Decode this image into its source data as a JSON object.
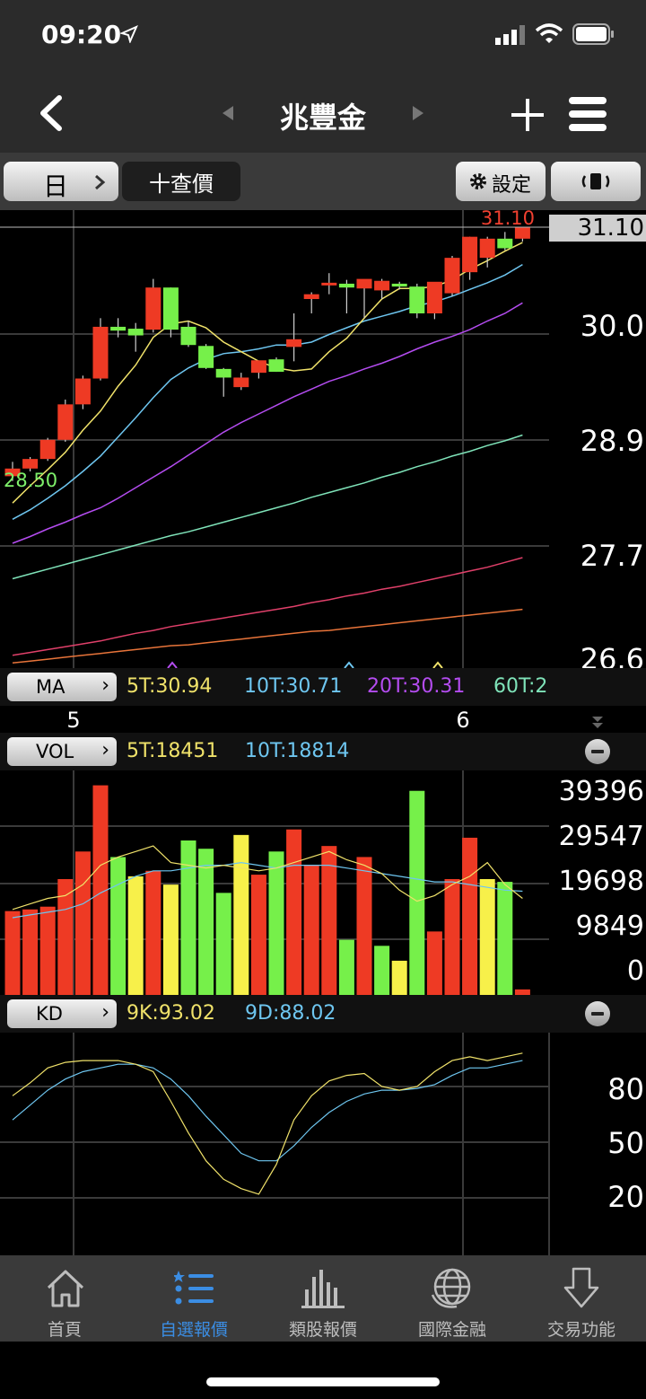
{
  "status": {
    "time": "09:20"
  },
  "nav": {
    "title": "兆豐金"
  },
  "toolbar": {
    "period_label": "日",
    "quote_label": "十查價",
    "settings_label": "設定"
  },
  "price_axis": {
    "current": "31.10",
    "labels": [
      "30.0",
      "28.9",
      "27.7",
      "26.6"
    ]
  },
  "ma": {
    "label": "MA",
    "high_marker": "31.10",
    "low_marker": "28.50",
    "ma5": "5T:30.94",
    "ma10": "10T:30.71",
    "ma20": "20T:30.31",
    "ma60": "60T:2",
    "colors": {
      "ma5": "#f0e26a",
      "ma10": "#6ec6f0",
      "ma20": "#b44cf0",
      "ma60": "#7fe3b9"
    }
  },
  "months": [
    "5",
    "6"
  ],
  "vol": {
    "label": "VOL",
    "v5": "5T:18451",
    "v10": "10T:18814",
    "axis": [
      "39396",
      "29547",
      "19698",
      "9849",
      "0"
    ]
  },
  "kd": {
    "label": "KD",
    "k": "9K:93.02",
    "d": "9D:88.02",
    "axis": [
      "80",
      "50",
      "20"
    ]
  },
  "tabs": [
    {
      "label": "首頁",
      "icon": "home-icon"
    },
    {
      "label": "自選報價",
      "icon": "list-icon"
    },
    {
      "label": "類股報價",
      "icon": "bar-chart-icon"
    },
    {
      "label": "國際金融",
      "icon": "globe-icon"
    },
    {
      "label": "交易功能",
      "icon": "download-icon"
    }
  ],
  "chart_data": {
    "type": "candlestick",
    "price_range": [
      26.6,
      31.1
    ],
    "candles": [
      {
        "o": 28.5,
        "h": 28.65,
        "l": 28.45,
        "c": 28.58
      },
      {
        "o": 28.58,
        "h": 28.7,
        "l": 28.55,
        "c": 28.68
      },
      {
        "o": 28.68,
        "h": 28.9,
        "l": 28.66,
        "c": 28.88
      },
      {
        "o": 28.88,
        "h": 29.3,
        "l": 28.86,
        "c": 29.25
      },
      {
        "o": 29.25,
        "h": 29.55,
        "l": 29.2,
        "c": 29.52
      },
      {
        "o": 29.52,
        "h": 30.15,
        "l": 29.5,
        "c": 30.06
      },
      {
        "o": 30.06,
        "h": 30.15,
        "l": 29.95,
        "c": 30.02
      },
      {
        "o": 30.04,
        "h": 30.1,
        "l": 29.8,
        "c": 29.97
      },
      {
        "o": 30.03,
        "h": 30.56,
        "l": 30.0,
        "c": 30.47
      },
      {
        "o": 30.47,
        "h": 30.47,
        "l": 29.95,
        "c": 30.03
      },
      {
        "o": 30.06,
        "h": 30.12,
        "l": 29.85,
        "c": 29.87
      },
      {
        "o": 29.86,
        "h": 29.88,
        "l": 29.62,
        "c": 29.63
      },
      {
        "o": 29.62,
        "h": 29.63,
        "l": 29.33,
        "c": 29.53
      },
      {
        "o": 29.43,
        "h": 29.58,
        "l": 29.4,
        "c": 29.53
      },
      {
        "o": 29.58,
        "h": 29.7,
        "l": 29.52,
        "c": 29.71
      },
      {
        "o": 29.72,
        "h": 29.74,
        "l": 29.59,
        "c": 29.59
      },
      {
        "o": 29.85,
        "h": 30.2,
        "l": 29.7,
        "c": 29.93
      },
      {
        "o": 30.35,
        "h": 30.42,
        "l": 30.2,
        "c": 30.4
      },
      {
        "o": 30.5,
        "h": 30.62,
        "l": 30.4,
        "c": 30.52
      },
      {
        "o": 30.51,
        "h": 30.55,
        "l": 30.2,
        "c": 30.47
      },
      {
        "o": 30.46,
        "h": 30.52,
        "l": 30.15,
        "c": 30.56
      },
      {
        "o": 30.44,
        "h": 30.56,
        "l": 30.35,
        "c": 30.54
      },
      {
        "o": 30.51,
        "h": 30.53,
        "l": 30.45,
        "c": 30.48
      },
      {
        "o": 30.48,
        "h": 30.51,
        "l": 30.15,
        "c": 30.2
      },
      {
        "o": 30.2,
        "h": 30.52,
        "l": 30.14,
        "c": 30.53
      },
      {
        "o": 30.41,
        "h": 30.8,
        "l": 30.38,
        "c": 30.78
      },
      {
        "o": 30.63,
        "h": 31.0,
        "l": 30.55,
        "c": 31.0
      },
      {
        "o": 30.78,
        "h": 31.0,
        "l": 30.68,
        "c": 30.98
      },
      {
        "o": 30.98,
        "h": 31.05,
        "l": 30.86,
        "c": 30.88
      },
      {
        "o": 30.98,
        "h": 31.1,
        "l": 30.95,
        "c": 31.1
      }
    ],
    "volume": [
      {
        "v": 15200,
        "c": "up"
      },
      {
        "v": 15500,
        "c": "up"
      },
      {
        "v": 16000,
        "c": "up"
      },
      {
        "v": 21000,
        "c": "up"
      },
      {
        "v": 26000,
        "c": "up"
      },
      {
        "v": 38000,
        "c": "up"
      },
      {
        "v": 25000,
        "c": "down"
      },
      {
        "v": 21500,
        "c": "flat"
      },
      {
        "v": 22500,
        "c": "up"
      },
      {
        "v": 20000,
        "c": "flat"
      },
      {
        "v": 28000,
        "c": "down"
      },
      {
        "v": 26500,
        "c": "down"
      },
      {
        "v": 18500,
        "c": "down"
      },
      {
        "v": 29000,
        "c": "flat"
      },
      {
        "v": 21800,
        "c": "up"
      },
      {
        "v": 26000,
        "c": "down"
      },
      {
        "v": 30000,
        "c": "up"
      },
      {
        "v": 23500,
        "c": "up"
      },
      {
        "v": 27000,
        "c": "up"
      },
      {
        "v": 10000,
        "c": "down"
      },
      {
        "v": 25000,
        "c": "up"
      },
      {
        "v": 8900,
        "c": "down"
      },
      {
        "v": 6200,
        "c": "flat"
      },
      {
        "v": 37000,
        "c": "down"
      },
      {
        "v": 11500,
        "c": "up"
      },
      {
        "v": 21000,
        "c": "up"
      },
      {
        "v": 28500,
        "c": "up"
      },
      {
        "v": 21000,
        "c": "flat"
      },
      {
        "v": 20500,
        "c": "down"
      },
      {
        "v": 1000,
        "c": "up"
      }
    ],
    "ma5": [
      28.22,
      28.4,
      28.57,
      28.75,
      28.98,
      29.18,
      29.44,
      29.66,
      29.95,
      30.09,
      30.12,
      30.05,
      29.9,
      29.8,
      29.7,
      29.63,
      29.6,
      29.62,
      29.8,
      29.94,
      30.15,
      30.35,
      30.46,
      30.46,
      30.48,
      30.55,
      30.66,
      30.75,
      30.85,
      30.94
    ],
    "ma10": [
      28.05,
      28.15,
      28.27,
      28.4,
      28.55,
      28.71,
      28.91,
      29.11,
      29.32,
      29.51,
      29.63,
      29.72,
      29.78,
      29.8,
      29.83,
      29.87,
      29.87,
      29.9,
      29.98,
      30.05,
      30.12,
      30.17,
      30.22,
      30.28,
      30.32,
      30.38,
      30.45,
      30.52,
      30.6,
      30.71
    ],
    "ma20": [
      27.8,
      27.87,
      27.95,
      28.02,
      28.1,
      28.17,
      28.27,
      28.38,
      28.49,
      28.6,
      28.72,
      28.84,
      28.96,
      29.06,
      29.15,
      29.24,
      29.33,
      29.41,
      29.49,
      29.55,
      29.62,
      29.68,
      29.75,
      29.83,
      29.9,
      29.96,
      30.03,
      30.12,
      30.2,
      30.31
    ],
    "ma60": [
      27.43,
      27.48,
      27.53,
      27.58,
      27.63,
      27.68,
      27.73,
      27.78,
      27.83,
      27.88,
      27.92,
      27.97,
      28.02,
      28.07,
      28.12,
      28.17,
      28.22,
      28.28,
      28.33,
      28.38,
      28.43,
      28.49,
      28.54,
      28.6,
      28.65,
      28.71,
      28.76,
      28.82,
      28.87,
      28.93
    ],
    "ma120": [
      26.63,
      26.66,
      26.69,
      26.72,
      26.75,
      26.78,
      26.82,
      26.86,
      26.89,
      26.93,
      26.96,
      26.99,
      27.02,
      27.05,
      27.08,
      27.11,
      27.14,
      27.18,
      27.21,
      27.25,
      27.28,
      27.32,
      27.35,
      27.39,
      27.43,
      27.47,
      27.51,
      27.55,
      27.6,
      27.65
    ],
    "ma240": [
      26.55,
      26.57,
      26.59,
      26.61,
      26.63,
      26.65,
      26.67,
      26.69,
      26.71,
      26.73,
      26.74,
      26.76,
      26.78,
      26.8,
      26.82,
      26.84,
      26.86,
      26.88,
      26.89,
      26.91,
      26.93,
      26.95,
      26.97,
      26.99,
      27.01,
      27.03,
      27.05,
      27.07,
      27.09,
      27.11
    ],
    "vol_ma5": [
      15500,
      16500,
      17500,
      18000,
      20000,
      23500,
      25000,
      26000,
      27000,
      24000,
      23500,
      23000,
      23500,
      23000,
      22500,
      23000,
      24000,
      25000,
      26000,
      24500,
      23500,
      22000,
      19000,
      17000,
      18000,
      20000,
      21500,
      24000,
      20000,
      17500
    ],
    "vol_ma10": [
      14000,
      14500,
      15000,
      15500,
      16500,
      18500,
      20000,
      21500,
      22500,
      22500,
      23000,
      23500,
      23500,
      24000,
      23500,
      23000,
      23500,
      23500,
      23500,
      23000,
      22500,
      22000,
      21500,
      21000,
      20500,
      20500,
      20000,
      19500,
      19000,
      18800
    ],
    "k": [
      75,
      82,
      90,
      93,
      94,
      94,
      94,
      92,
      88,
      72,
      55,
      40,
      30,
      25,
      22,
      38,
      62,
      75,
      83,
      86,
      87,
      80,
      78,
      80,
      88,
      94,
      96,
      94,
      96,
      98
    ],
    "d": [
      62,
      70,
      78,
      84,
      88,
      90,
      92,
      92,
      90,
      84,
      75,
      64,
      54,
      44,
      40,
      40,
      48,
      58,
      66,
      72,
      76,
      78,
      78,
      79,
      81,
      86,
      90,
      90,
      92,
      94
    ]
  }
}
